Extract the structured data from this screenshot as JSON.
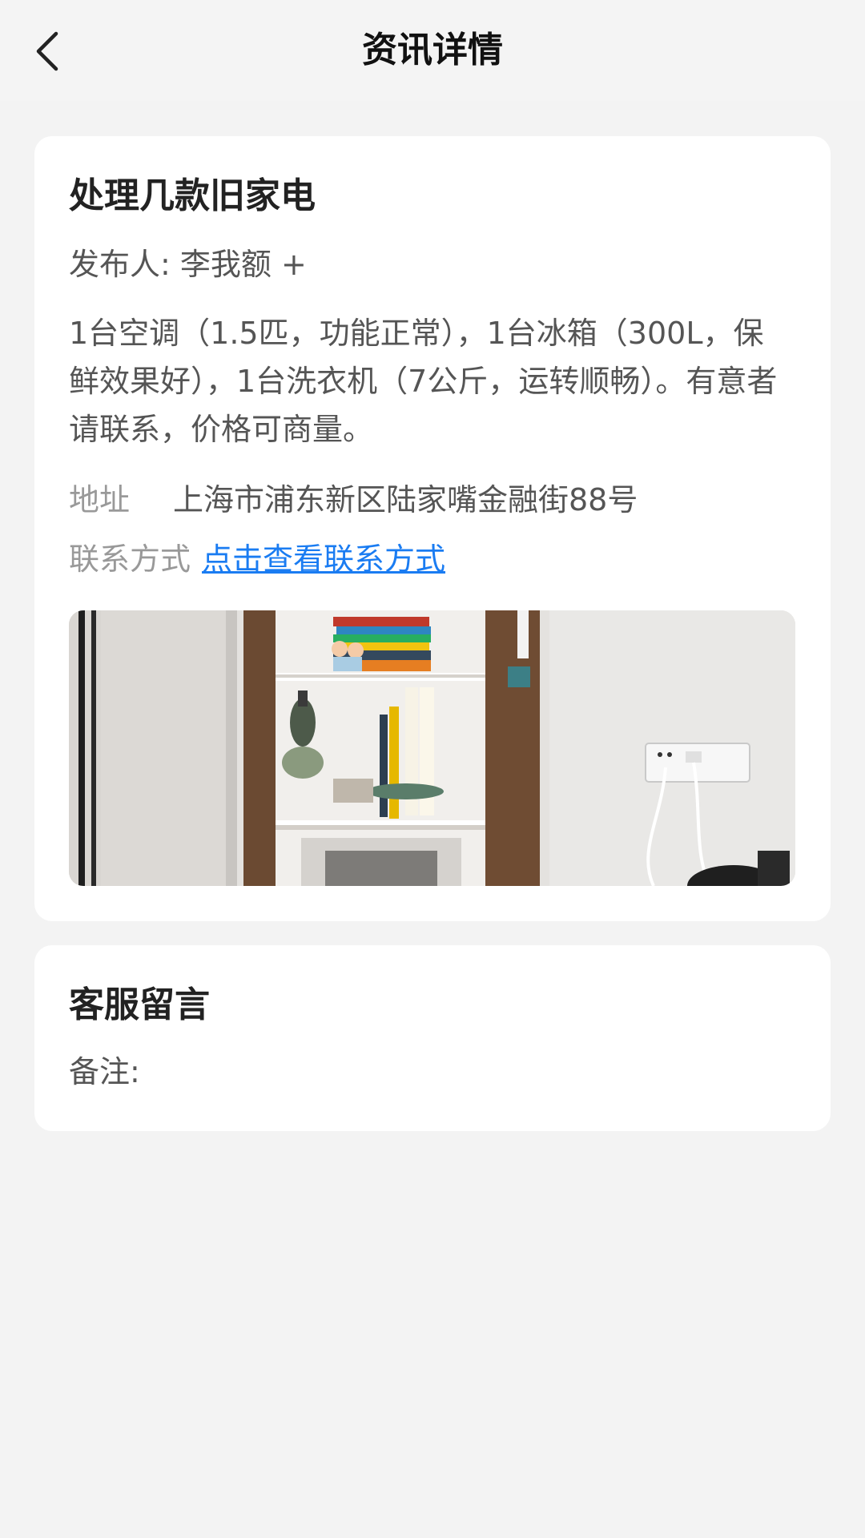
{
  "navbar": {
    "back_icon": "chevron-left-icon",
    "title": "资讯详情"
  },
  "post": {
    "title": "处理几款旧家电",
    "publisher_label": "发布人:",
    "publisher_name": "李我额",
    "publisher_suffix": "+",
    "description": "1台空调（1.5匹，功能正常），1台冰箱（300L，保鲜效果好），1台洗衣机（7公斤，运转顺畅）。有意者请联系，价格可商量。",
    "address_label": "地址",
    "address_value": "上海市浦东新区陆家嘴金融街88号",
    "contact_label": "联系方式",
    "contact_link": "点击查看联系方式",
    "link_color": "#1a7cf2"
  },
  "message": {
    "title": "客服留言",
    "note_label": "备注:",
    "note_value": ""
  }
}
